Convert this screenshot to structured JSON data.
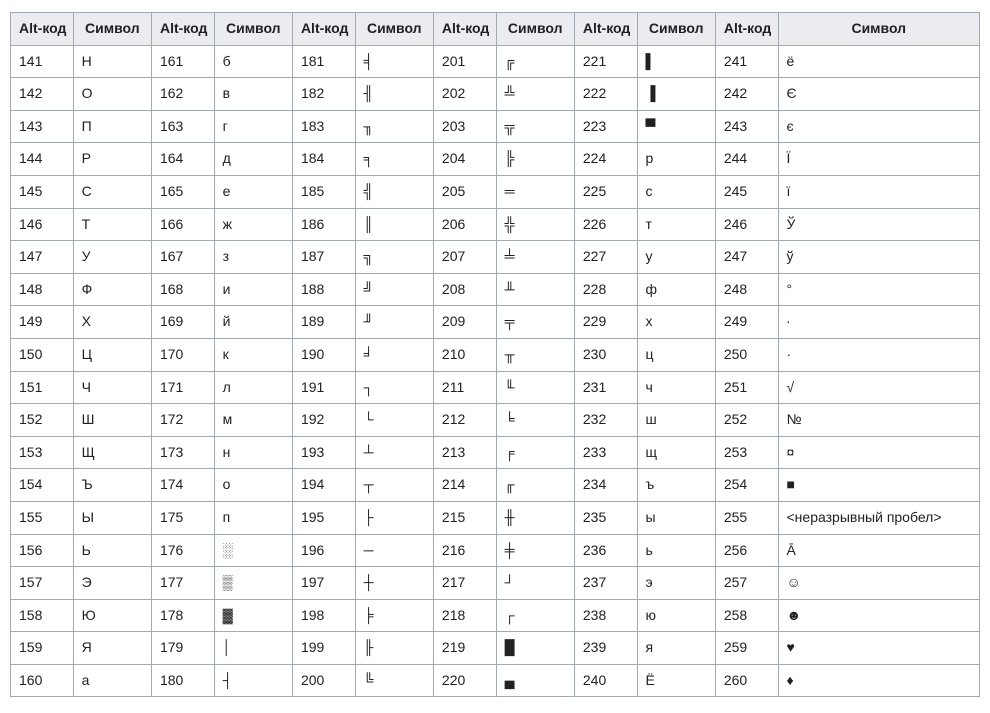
{
  "headers": {
    "code": "Alt-код",
    "symbol": "Символ"
  },
  "columns": [
    {
      "start": 141,
      "end": 160,
      "symbols": [
        "Н",
        "О",
        "П",
        "Р",
        "С",
        "Т",
        "У",
        "Ф",
        "Х",
        "Ц",
        "Ч",
        "Ш",
        "Щ",
        "Ъ",
        "Ы",
        "Ь",
        "Э",
        "Ю",
        "Я",
        "а"
      ]
    },
    {
      "start": 161,
      "end": 180,
      "symbols": [
        "б",
        "в",
        "г",
        "д",
        "е",
        "ж",
        "з",
        "и",
        "й",
        "к",
        "л",
        "м",
        "н",
        "о",
        "п",
        "░",
        "▒",
        "▓",
        "│",
        "┤"
      ]
    },
    {
      "start": 181,
      "end": 200,
      "symbols": [
        "╡",
        "╢",
        "╖",
        "╕",
        "╣",
        "║",
        "╗",
        "╝",
        "╜",
        "╛",
        "┐",
        "└",
        "┴",
        "┬",
        "├",
        "─",
        "┼",
        "╞",
        "╟",
        "╚"
      ]
    },
    {
      "start": 201,
      "end": 220,
      "symbols": [
        "╔",
        "╩",
        "╦",
        "╠",
        "═",
        "╬",
        "╧",
        "╨",
        "╤",
        "╥",
        "╙",
        "╘",
        "╒",
        "╓",
        "╫",
        "╪",
        "┘",
        "┌",
        "█",
        "▄"
      ]
    },
    {
      "start": 221,
      "end": 240,
      "symbols": [
        "▌",
        "▐",
        "▀",
        "р",
        "с",
        "т",
        "у",
        "ф",
        "х",
        "ц",
        "ч",
        "ш",
        "щ",
        "ъ",
        "ы",
        "ь",
        "э",
        "ю",
        "я",
        "Ё"
      ]
    },
    {
      "start": 241,
      "end": 260,
      "symbols": [
        "ё",
        "Є",
        "є",
        "Ї",
        "ї",
        "Ў",
        "ў",
        "°",
        "∙",
        "·",
        "√",
        "№",
        "¤",
        "■",
        "<неразрывный пробел>",
        "Ā",
        "☺",
        "☻",
        "♥",
        "♦"
      ]
    }
  ]
}
